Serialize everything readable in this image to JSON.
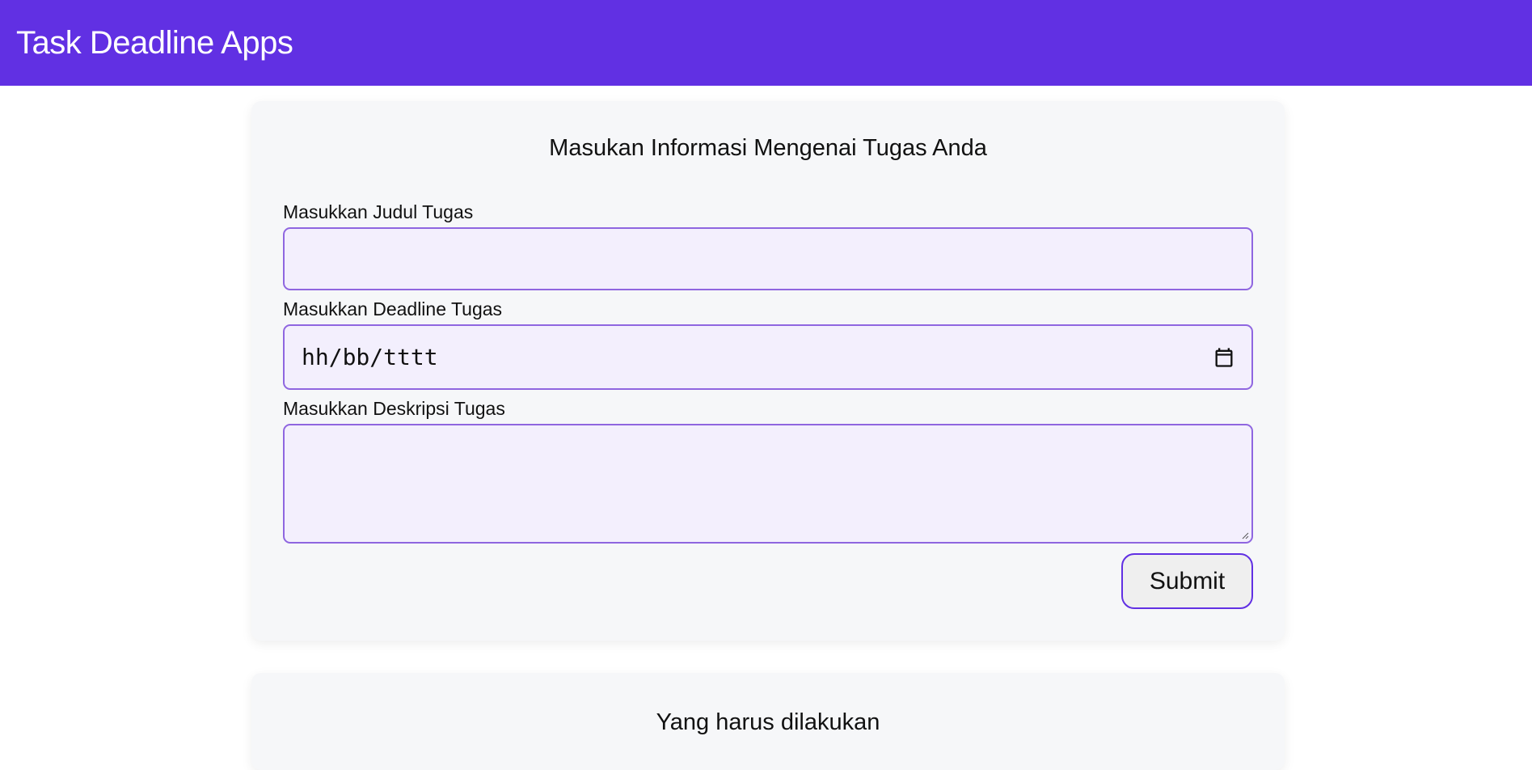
{
  "header": {
    "title": "Task Deadline Apps"
  },
  "form": {
    "heading": "Masukan Informasi Mengenai Tugas Anda",
    "title_label": "Masukkan Judul Tugas",
    "title_value": "",
    "deadline_label": "Masukkan Deadline Tugas",
    "deadline_placeholder": "hh/bb/tttt",
    "description_label": "Masukkan Deskripsi Tugas",
    "description_value": "",
    "submit_label": "Submit"
  },
  "todo": {
    "heading": "Yang harus dilakukan"
  },
  "colors": {
    "header_bg": "#6130e3",
    "input_bg": "#f3effd",
    "input_border": "#8f66e0",
    "card_bg": "#f6f7f9"
  },
  "icons": {
    "date_picker": "calendar-icon",
    "textarea_resize": "resize-handle-icon"
  }
}
